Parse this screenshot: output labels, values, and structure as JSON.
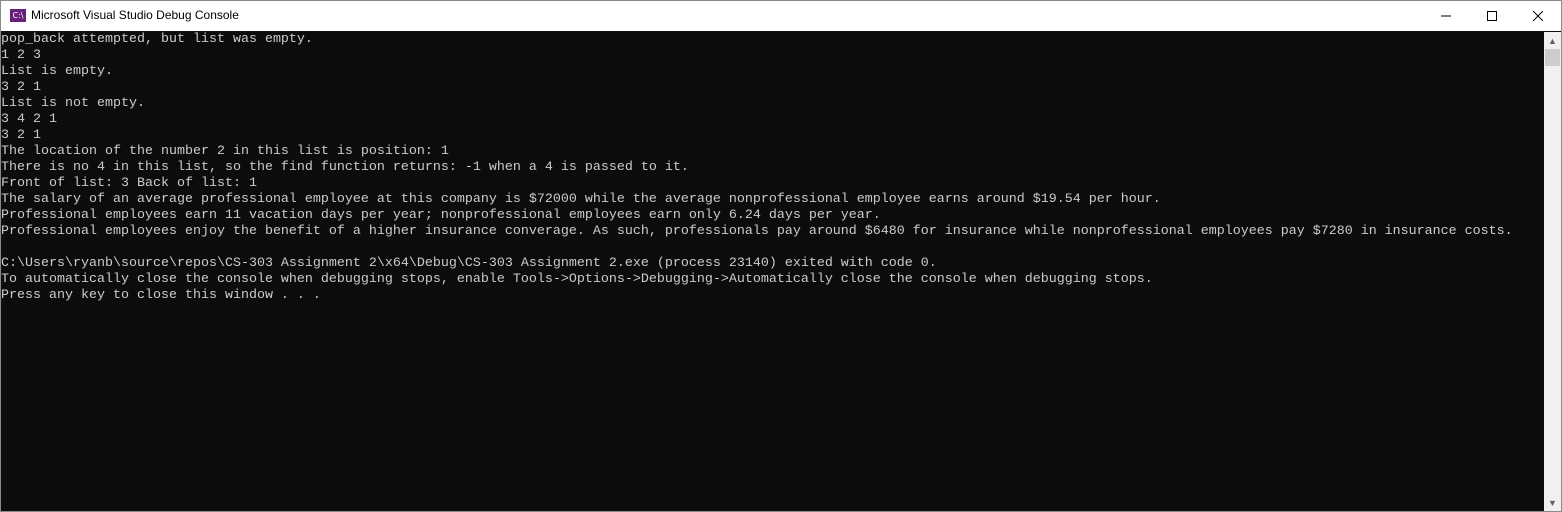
{
  "window": {
    "title": "Microsoft Visual Studio Debug Console",
    "icon_label": "C:\\",
    "icon": "console-app-icon"
  },
  "controls": {
    "minimize": "minimize-icon",
    "maximize": "maximize-icon",
    "close": "close-icon"
  },
  "console": {
    "lines": [
      "pop_back attempted, but list was empty.",
      "1 2 3",
      "List is empty.",
      "3 2 1",
      "List is not empty.",
      "3 4 2 1",
      "3 2 1",
      "The location of the number 2 in this list is position: 1",
      "There is no 4 in this list, so the find function returns: -1 when a 4 is passed to it.",
      "Front of list: 3 Back of list: 1",
      "The salary of an average professional employee at this company is $72000 while the average nonprofessional employee earns around $19.54 per hour.",
      "Professional employees earn 11 vacation days per year; nonprofessional employees earn only 6.24 days per year.",
      "Professional employees enjoy the benefit of a higher insurance converage. As such, professionals pay around $6480 for insurance while nonprofessional employees pay $7280 in insurance costs.",
      "",
      "C:\\Users\\ryanb\\source\\repos\\CS-303 Assignment 2\\x64\\Debug\\CS-303 Assignment 2.exe (process 23140) exited with code 0.",
      "To automatically close the console when debugging stops, enable Tools->Options->Debugging->Automatically close the console when debugging stops.",
      "Press any key to close this window . . ."
    ]
  },
  "scrollbar": {
    "position": 0
  }
}
